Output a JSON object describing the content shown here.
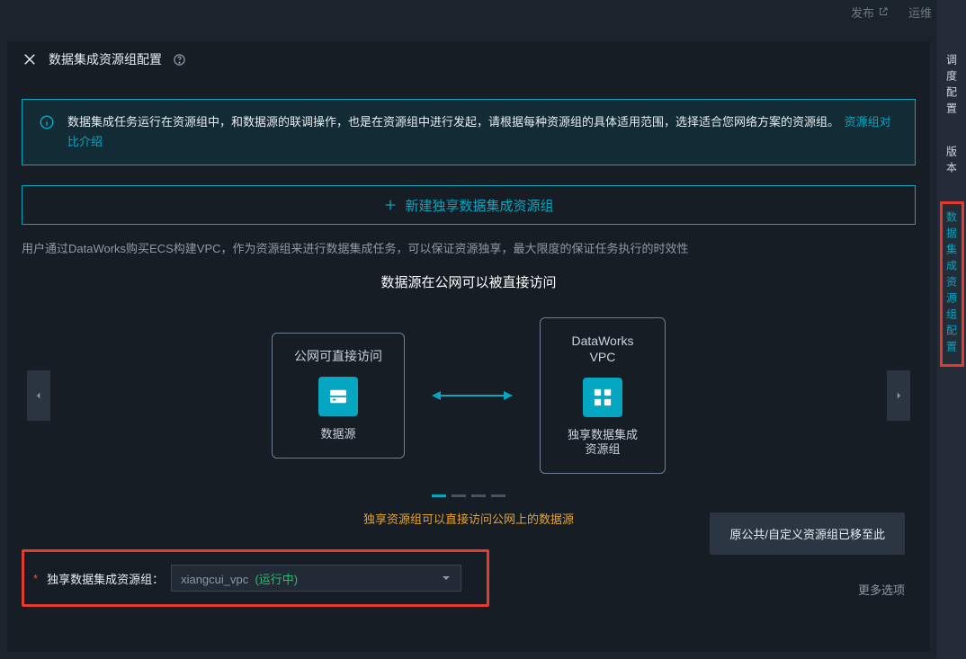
{
  "top": {
    "publish_label": "发布",
    "ops_label": "运维"
  },
  "right_rail": {
    "tabs": [
      "调度配置",
      "版本",
      "数据集成资源组配置"
    ]
  },
  "panel": {
    "title": "数据集成资源组配置",
    "alert_text": "数据集成任务运行在资源组中，和数据源的联调操作，也是在资源组中进行发起，请根据每种资源组的具体适用范围，选择适合您网络方案的资源组。",
    "alert_link": "资源组对比介绍",
    "create_label": "新建独享数据集成资源组",
    "description": "用户通过DataWorks购买ECS构建VPC，作为资源组来进行数据集成任务，可以保证资源独享，最大限度的保证任务执行的时效性",
    "diagram_title": "数据源在公网可以被直接访问",
    "box_left_caption": "公网可直接访问",
    "box_left_sub": "数据源",
    "box_right_caption_line1": "DataWorks",
    "box_right_caption_line2": "VPC",
    "box_right_sub_line1": "独享数据集成",
    "box_right_sub_line2": "资源组",
    "sub_description": "独享资源组可以直接访问公网上的数据源",
    "toast": "原公共/自定义资源组已移至此",
    "more_options": "更多选项",
    "field_label": "独享数据集成资源组：",
    "select_value": "xiangcui_vpc",
    "select_status": "(运行中)"
  }
}
